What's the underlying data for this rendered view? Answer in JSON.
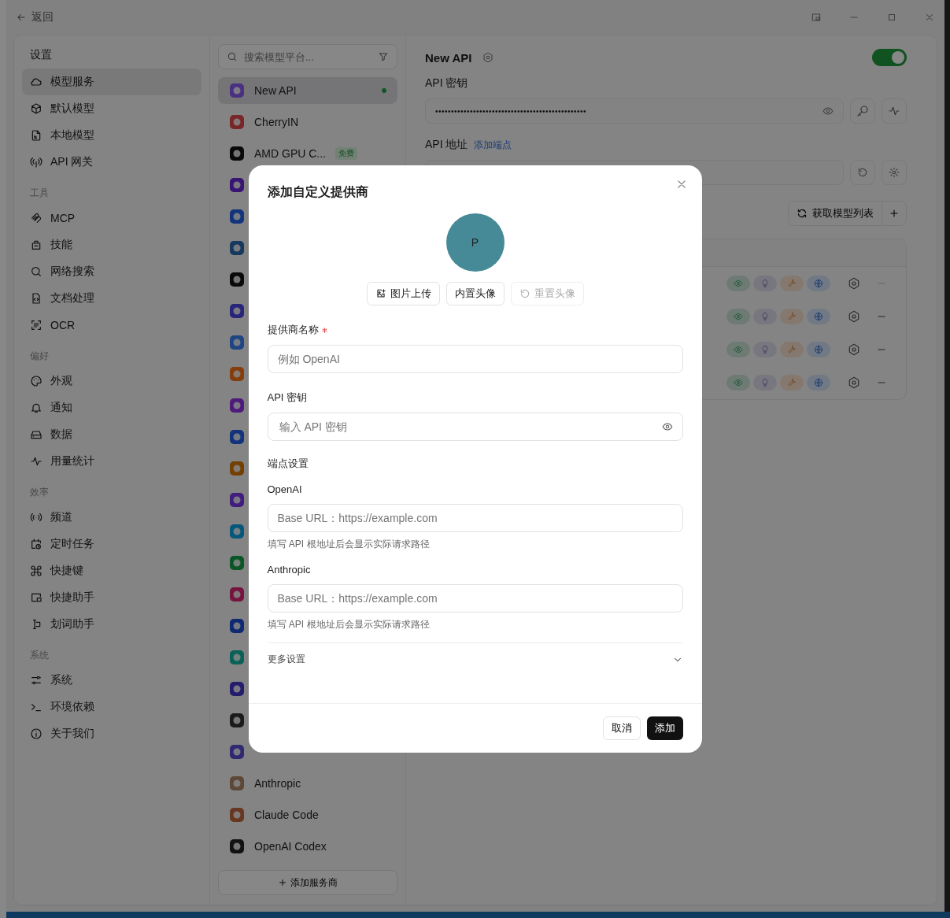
{
  "titlebar": {
    "back_label": "返回"
  },
  "sidebar": {
    "title": "设置",
    "groups": [
      {
        "items": [
          {
            "label": "模型服务",
            "selected": true
          },
          {
            "label": "默认模型",
            "selected": false
          },
          {
            "label": "本地模型",
            "selected": false
          },
          {
            "label": "API 网关",
            "selected": false
          }
        ]
      },
      {
        "heading": "工具",
        "items": [
          {
            "label": "MCP",
            "selected": false
          },
          {
            "label": "技能",
            "selected": false
          },
          {
            "label": "网络搜索",
            "selected": false
          },
          {
            "label": "文档处理",
            "selected": false
          },
          {
            "label": "OCR",
            "selected": false
          }
        ]
      },
      {
        "heading": "偏好",
        "items": [
          {
            "label": "外观",
            "selected": false
          },
          {
            "label": "通知",
            "selected": false
          },
          {
            "label": "数据",
            "selected": false
          },
          {
            "label": "用量统计",
            "selected": false
          }
        ]
      },
      {
        "heading": "效率",
        "items": [
          {
            "label": "频道",
            "selected": false
          },
          {
            "label": "定时任务",
            "selected": false
          },
          {
            "label": "快捷键",
            "selected": false
          },
          {
            "label": "快捷助手",
            "selected": false
          },
          {
            "label": "划词助手",
            "selected": false
          }
        ]
      },
      {
        "heading": "系统",
        "items": [
          {
            "label": "系统",
            "selected": false
          },
          {
            "label": "环境依赖",
            "selected": false
          },
          {
            "label": "关于我们",
            "selected": false
          }
        ]
      }
    ]
  },
  "providers": {
    "search_placeholder": "搜索模型平台...",
    "add_label": "添加服务商",
    "items": [
      {
        "kind": "named",
        "name": "New API",
        "selected": true,
        "active": true
      },
      {
        "kind": "named",
        "name": "CherryIN",
        "selected": false,
        "active": false
      },
      {
        "kind": "named",
        "name": "AMD GPU C...",
        "badge": "免费",
        "selected": false,
        "active": false
      },
      {
        "kind": "covered"
      },
      {
        "kind": "covered"
      },
      {
        "kind": "covered"
      },
      {
        "kind": "covered"
      },
      {
        "kind": "covered"
      },
      {
        "kind": "covered"
      },
      {
        "kind": "covered"
      },
      {
        "kind": "covered"
      },
      {
        "kind": "covered"
      },
      {
        "kind": "covered"
      },
      {
        "kind": "covered"
      },
      {
        "kind": "covered"
      },
      {
        "kind": "covered"
      },
      {
        "kind": "covered"
      },
      {
        "kind": "covered"
      },
      {
        "kind": "covered"
      },
      {
        "kind": "covered"
      },
      {
        "kind": "covered"
      },
      {
        "kind": "covered"
      },
      {
        "kind": "named",
        "name": "Anthropic",
        "selected": false,
        "active": false
      },
      {
        "kind": "named",
        "name": "Claude Code",
        "selected": false,
        "active": false
      },
      {
        "kind": "named",
        "name": "OpenAI Codex",
        "selected": false,
        "active": false
      }
    ]
  },
  "detail": {
    "title": "New API",
    "enabled": true,
    "api_key_label": "API 密钥",
    "api_key_value": "••••••••••••••••••••••••••••••••••••••••••••••••",
    "api_address_label": "API 地址",
    "add_endpoint_link": "添加端点",
    "fetch_models_label": "获取模型列表",
    "models": [
      {
        "remove_disabled": true
      },
      {
        "remove_disabled": false
      },
      {
        "remove_disabled": false
      },
      {
        "remove_disabled": false
      }
    ]
  },
  "modal": {
    "title": "添加自定义提供商",
    "avatar_letter": "P",
    "avatar_buttons": [
      {
        "label": "图片上传",
        "kind": "upload",
        "disabled": false
      },
      {
        "label": "内置头像",
        "kind": "plain",
        "disabled": false
      },
      {
        "label": "重置头像",
        "kind": "reset",
        "disabled": true
      }
    ],
    "name_label": "提供商名称",
    "name_required": true,
    "name_placeholder": "例如 OpenAI",
    "key_label": "API 密钥",
    "key_placeholder": "输入 API 密钥",
    "endpoints_heading": "端点设置",
    "endpoints": [
      {
        "label": "OpenAI",
        "placeholder": "Base URL：https://example.com",
        "hint": "填写 API 根地址后会显示实际请求路径"
      },
      {
        "label": "Anthropic",
        "placeholder": "Base URL：https://example.com",
        "hint": "填写 API 根地址后会显示实际请求路径"
      }
    ],
    "more_settings": "更多设置",
    "more_expanded": false,
    "cancel_label": "取消",
    "submit_label": "添加"
  }
}
